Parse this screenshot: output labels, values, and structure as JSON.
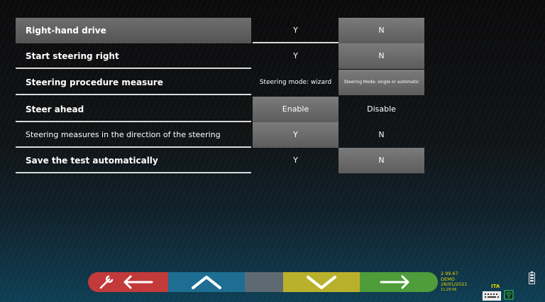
{
  "rows": [
    {
      "label": "Right-hand drive",
      "bold": true,
      "selected": true,
      "option_a": "Y",
      "option_b": "N",
      "active": "b"
    },
    {
      "label": "Start steering right",
      "bold": true,
      "selected": false,
      "option_a": "Y",
      "option_b": "N",
      "active": "b"
    },
    {
      "label": "Steering procedure measure",
      "bold": true,
      "selected": false,
      "option_a": "Steering mode: wizard",
      "option_b": "Steering Mode: single or automatic",
      "active": "b"
    },
    {
      "label": "Steer ahead",
      "bold": true,
      "selected": false,
      "option_a": "Enable",
      "option_b": "Disable",
      "active": "a"
    },
    {
      "label": "Steering measures in the direction of the steering",
      "bold": false,
      "selected": false,
      "option_a": "Y",
      "option_b": "N",
      "active": "a"
    },
    {
      "label": "Save the test automatically",
      "bold": true,
      "selected": false,
      "option_a": "Y",
      "option_b": "N",
      "active": "b"
    }
  ],
  "toolbar": {
    "tools_back_icon": "wrench-back-arrow-icon",
    "up_icon": "chevron-up-icon",
    "down_icon": "chevron-down-icon",
    "next_icon": "arrow-right-icon",
    "colors": {
      "red": "#c23a3a",
      "blue": "#1d6e92",
      "gray": "#5e6a72",
      "yellow": "#b9b12b",
      "green": "#4f9c3b"
    }
  },
  "status": {
    "version": "2.99.67",
    "mode": "DEMO",
    "date": "28/01/2021",
    "time": "11:29:56",
    "language": "ITA"
  }
}
